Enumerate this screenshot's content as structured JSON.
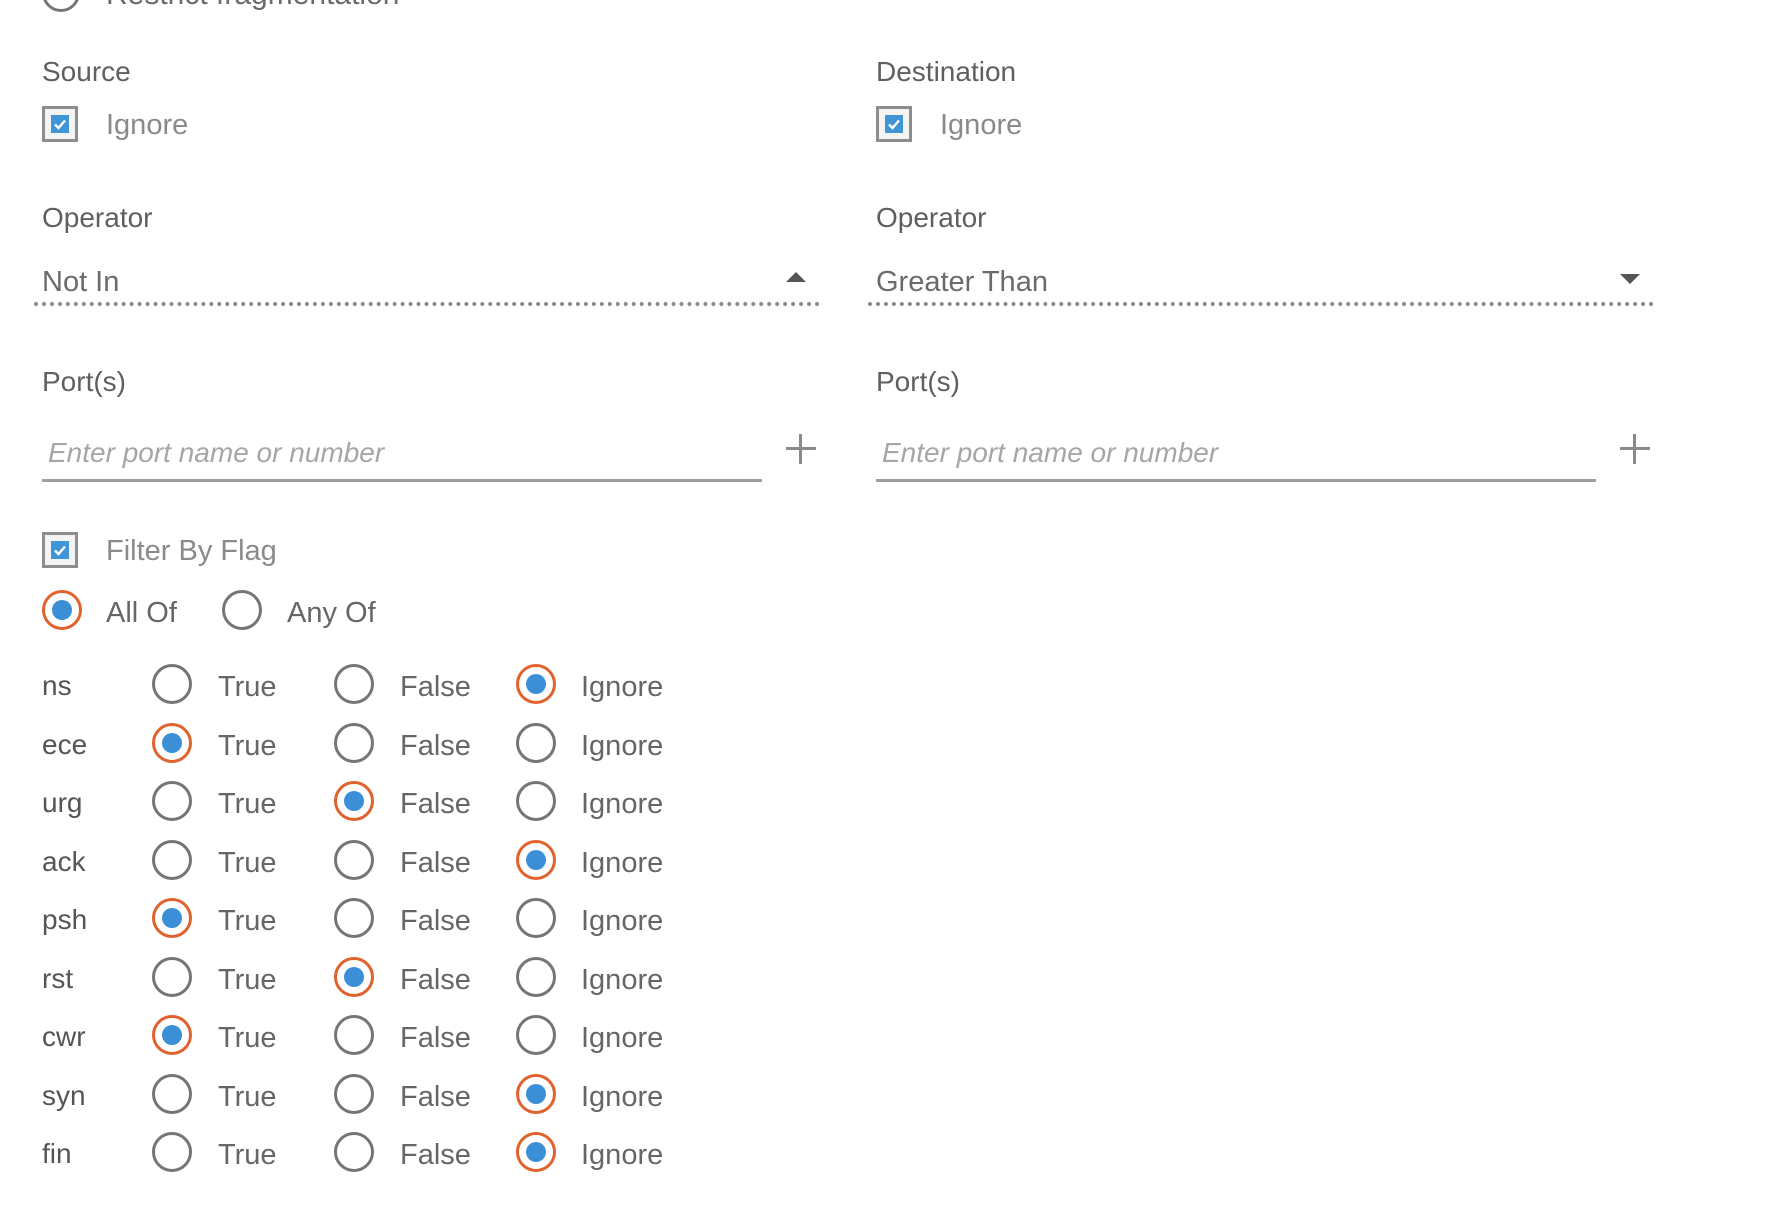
{
  "top_row": {
    "label": "Restrict fragmentation"
  },
  "source": {
    "title": "Source",
    "ignore_label": "Ignore",
    "ignore_checked": true,
    "operator_label": "Operator",
    "operator_value": "Not In",
    "ports_label": "Port(s)",
    "ports_placeholder": "Enter port name or number"
  },
  "destination": {
    "title": "Destination",
    "ignore_label": "Ignore",
    "ignore_checked": true,
    "operator_label": "Operator",
    "operator_value": "Greater Than",
    "ports_label": "Port(s)",
    "ports_placeholder": "Enter port name or number"
  },
  "filter_by_flag": {
    "label": "Filter By Flag",
    "checked": true,
    "mode_options": [
      "All Of",
      "Any Of"
    ],
    "mode_selected": "All Of",
    "choice_labels": [
      "True",
      "False",
      "Ignore"
    ],
    "flags": [
      {
        "name": "ns",
        "selected": "Ignore"
      },
      {
        "name": "ece",
        "selected": "True"
      },
      {
        "name": "urg",
        "selected": "False"
      },
      {
        "name": "ack",
        "selected": "Ignore"
      },
      {
        "name": "psh",
        "selected": "True"
      },
      {
        "name": "rst",
        "selected": "False"
      },
      {
        "name": "cwr",
        "selected": "True"
      },
      {
        "name": "syn",
        "selected": "Ignore"
      },
      {
        "name": "fin",
        "selected": "Ignore"
      }
    ]
  },
  "colors": {
    "accent_ring": "#e0622d",
    "accent_fill": "#3b8fd6",
    "checkbox_fill": "#3f95d6"
  }
}
